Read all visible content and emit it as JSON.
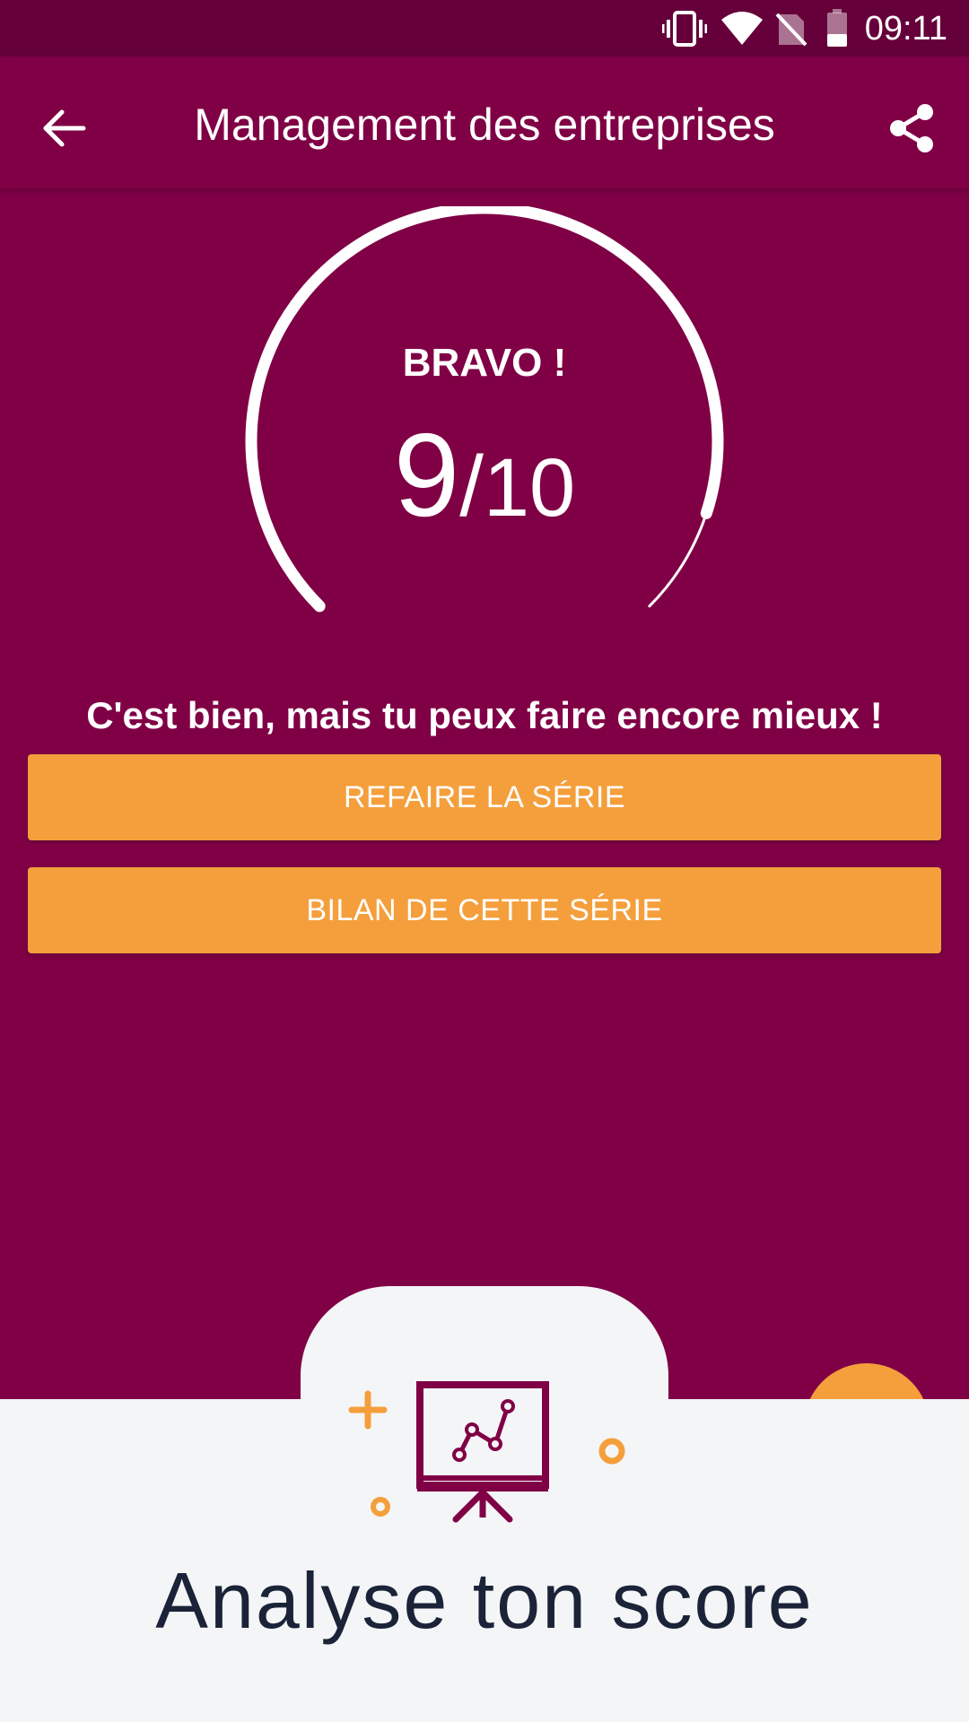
{
  "status_bar": {
    "time": "09:11",
    "icons": [
      "vibrate-icon",
      "wifi-icon",
      "no-sim-icon",
      "battery-icon"
    ]
  },
  "app_bar": {
    "title": "Management des entreprises",
    "back_icon": "arrow-left-icon",
    "share_icon": "share-icon"
  },
  "result": {
    "heading": "BRAVO !",
    "score": "9",
    "separator": "/",
    "total": "10",
    "progress_fraction": 0.9,
    "feedback": "C'est bien, mais tu peux faire encore mieux !"
  },
  "actions": {
    "retry_label": "REFAIRE LA SÉRIE",
    "summary_label": "BILAN DE CETTE SÉRIE"
  },
  "bottom_panel": {
    "title": "Analyse ton score",
    "illustration": "presentation-chart-icon"
  },
  "colors": {
    "primary": "#800046",
    "status_bar": "#66003a",
    "accent": "#f49f3c",
    "panel_background": "#f4f5f7",
    "title_text": "#1b2338"
  }
}
